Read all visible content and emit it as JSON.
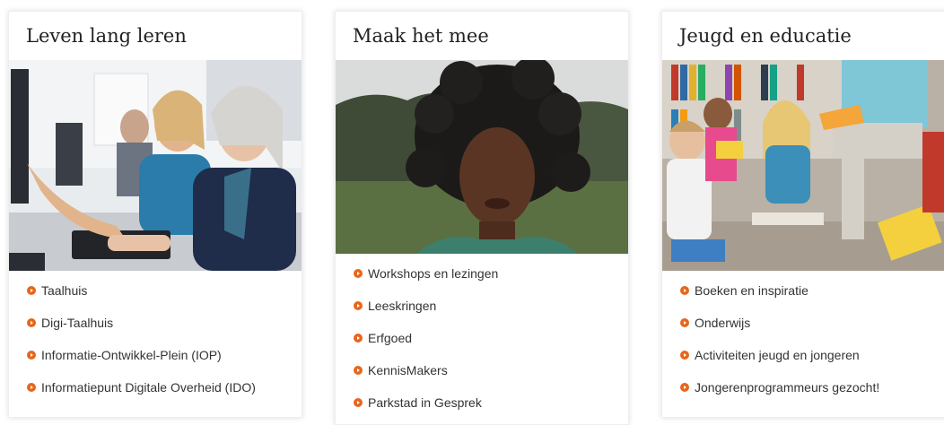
{
  "accent_color": "#e8661c",
  "cards": [
    {
      "title": "Leven lang leren",
      "image_icon": "photo-seniors-at-computer",
      "links": [
        "Taalhuis",
        "Digi-Taalhuis",
        "Informatie-Ontwikkel-Plein (IOP)",
        "Informatiepunt Digitale Overheid (IDO)"
      ]
    },
    {
      "title": "Maak het mee",
      "image_icon": "photo-woman-curly-hair",
      "links": [
        "Workshops en lezingen",
        "Leeskringen",
        "Erfgoed",
        "KennisMakers",
        "Parkstad in Gesprek"
      ]
    },
    {
      "title": "Jeugd en educatie",
      "image_icon": "photo-children-reading",
      "links": [
        "Boeken en inspiratie",
        "Onderwijs",
        "Activiteiten jeugd en jongeren",
        "Jongerenprogrammeurs gezocht!"
      ]
    }
  ]
}
